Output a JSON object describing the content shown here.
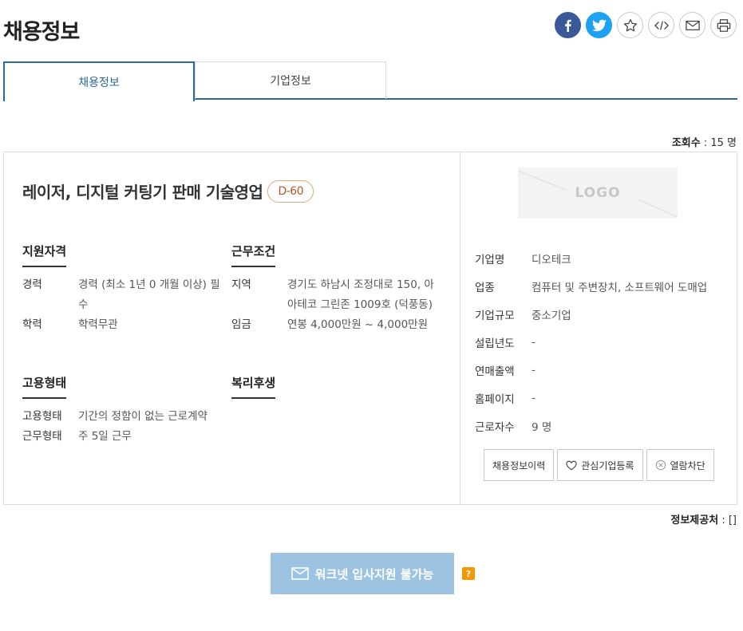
{
  "page": {
    "title": "채용정보"
  },
  "share": {
    "buttons": [
      {
        "name": "facebook-icon",
        "color": "#3b5998"
      },
      {
        "name": "twitter-icon",
        "color": "#1da1f2"
      },
      {
        "name": "star-icon"
      },
      {
        "name": "embed-code-icon"
      },
      {
        "name": "mail-icon"
      },
      {
        "name": "print-icon"
      }
    ]
  },
  "tabs": [
    {
      "label": "채용정보",
      "active": true
    },
    {
      "label": "기업정보",
      "active": false
    }
  ],
  "view_count": {
    "label": "조회수",
    "value": ": 15 명"
  },
  "job": {
    "title": "레이저, 디지털 커팅기 판매 기술영업",
    "dday": "D-60"
  },
  "qualifications": {
    "heading": "지원자격",
    "rows": [
      {
        "label": "경력",
        "value": "경력 (최소 1년 0 개월 이상) 필수"
      },
      {
        "label": "학력",
        "value": "학력무관"
      }
    ]
  },
  "conditions": {
    "heading": "근무조건",
    "rows": [
      {
        "label": "지역",
        "value": "경기도 하남시 조정대로 150, 아아테코 그린존 1009호 (덕풍동)"
      },
      {
        "label": "임금",
        "value": "연봉 4,000만원 ~ 4,000만원"
      }
    ]
  },
  "employment": {
    "heading": "고용형태",
    "rows": [
      {
        "label": "고용형태",
        "value": "기간의 정함이 없는 근로계약"
      },
      {
        "label": "근무형태",
        "value": "주 5일 근무"
      }
    ]
  },
  "welfare": {
    "heading": "복리후생"
  },
  "company": {
    "logo_text": "LOGO",
    "rows": [
      {
        "label": "기업명",
        "value": "디오테크"
      },
      {
        "label": "업종",
        "value": "컴퓨터 및 주변장치, 소프트웨어 도매업"
      },
      {
        "label": "기업규모",
        "value": "중소기업"
      },
      {
        "label": "설립년도",
        "value": "-"
      },
      {
        "label": "연매출액",
        "value": "-"
      },
      {
        "label": "홈페이지",
        "value": "-"
      },
      {
        "label": "근로자수",
        "value": "9 명"
      }
    ],
    "buttons": {
      "history": "채용정보이력",
      "favorite": "관심기업등록",
      "block": "열람차단"
    }
  },
  "provider": {
    "label": "정보제공처",
    "value": ": []"
  },
  "apply": {
    "label": "워크넷 입사지원 불가능",
    "help": "?"
  },
  "colors": {
    "accent": "#2b6a9b",
    "apply_bg": "#9cc3e2",
    "help_bg": "#f39800",
    "dday": "#b5562a"
  }
}
